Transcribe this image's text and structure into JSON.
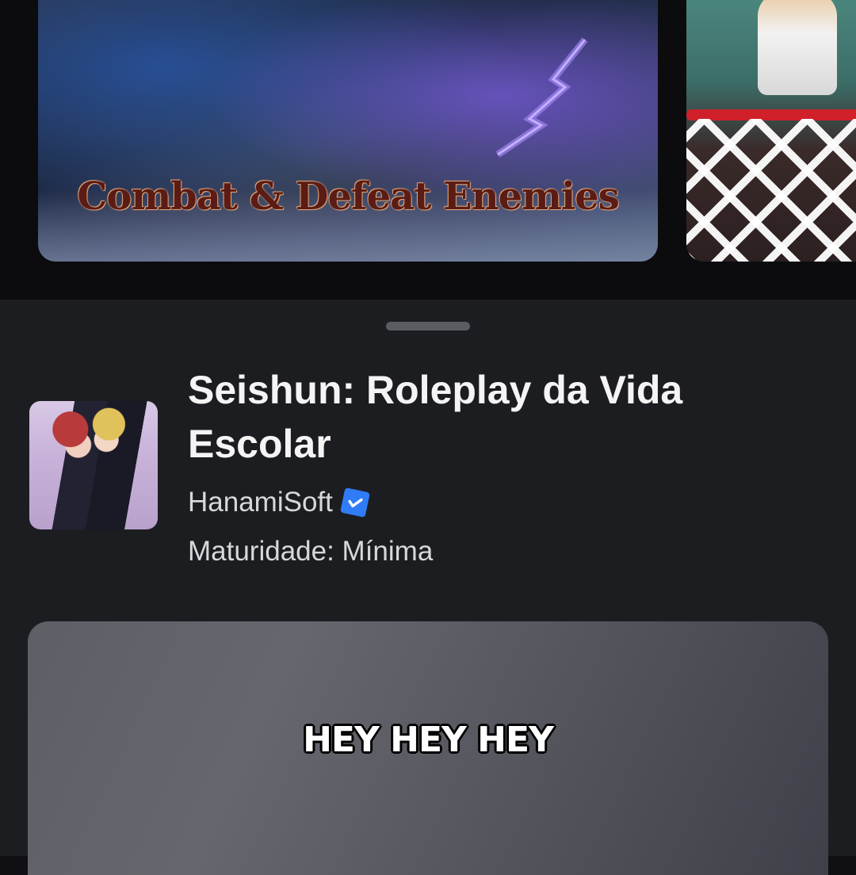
{
  "carousel": {
    "cards": [
      {
        "caption": "Combat & Defeat Enemies"
      },
      {
        "caption": ""
      }
    ]
  },
  "game": {
    "title": "Seishun: Roleplay da Vida Escolar",
    "creator": "HanamiSoft",
    "creator_verified": true,
    "maturity": "Maturidade: Mínima"
  },
  "media": {
    "overlay_text": "HEY HEY HEY"
  },
  "colors": {
    "sheet_background": "#1c1d21",
    "verified_badge": "#2f7cf6",
    "caption_text": "#5a1c14"
  },
  "icons": {
    "verified": "verified-badge-icon"
  }
}
